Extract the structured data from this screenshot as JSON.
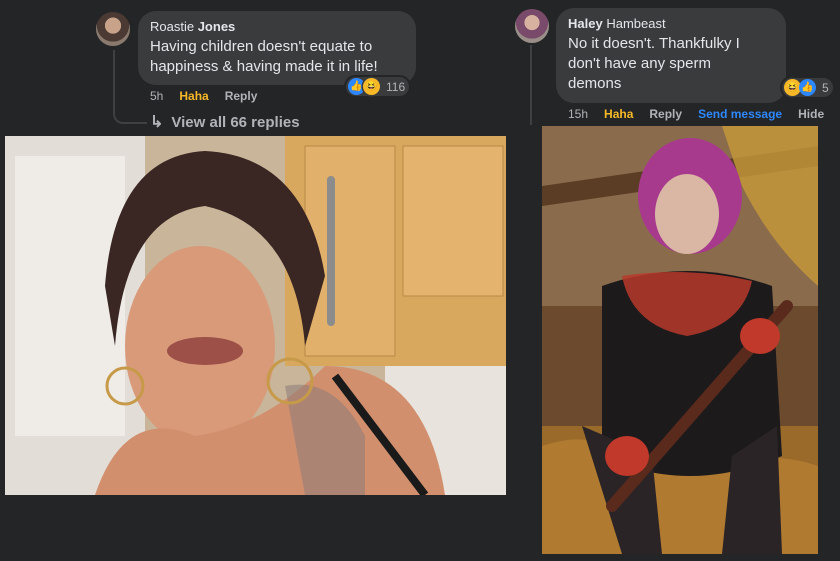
{
  "left_comment": {
    "author_first": "Roastie",
    "author_last": "Jones",
    "text_line1": "Having children doesn't equate to",
    "text_line2": "happiness & having made it in life!",
    "time": "5h",
    "haha_label": "Haha",
    "reply_label": "Reply",
    "reaction_count": "116",
    "reaction_icons": [
      "like-icon",
      "haha-icon"
    ],
    "view_replies": "View all 66 replies"
  },
  "right_comment": {
    "author_first": "Haley",
    "author_last": "Hambeast",
    "text_line1": "No it doesn't. Thankfulky I",
    "text_line2": "don't have any sperm",
    "text_line3": "demons",
    "time": "15h",
    "haha_label": "Haha",
    "reply_label": "Reply",
    "send_message_label": "Send message",
    "hide_label": "Hide",
    "reaction_count": "5",
    "reaction_icons": [
      "haha-icon",
      "like-icon"
    ]
  },
  "colors": {
    "background": "#242526",
    "bubble": "#3a3b3c",
    "haha": "#f7b928",
    "link": "#2d88ff",
    "muted": "#b0b3b8"
  }
}
